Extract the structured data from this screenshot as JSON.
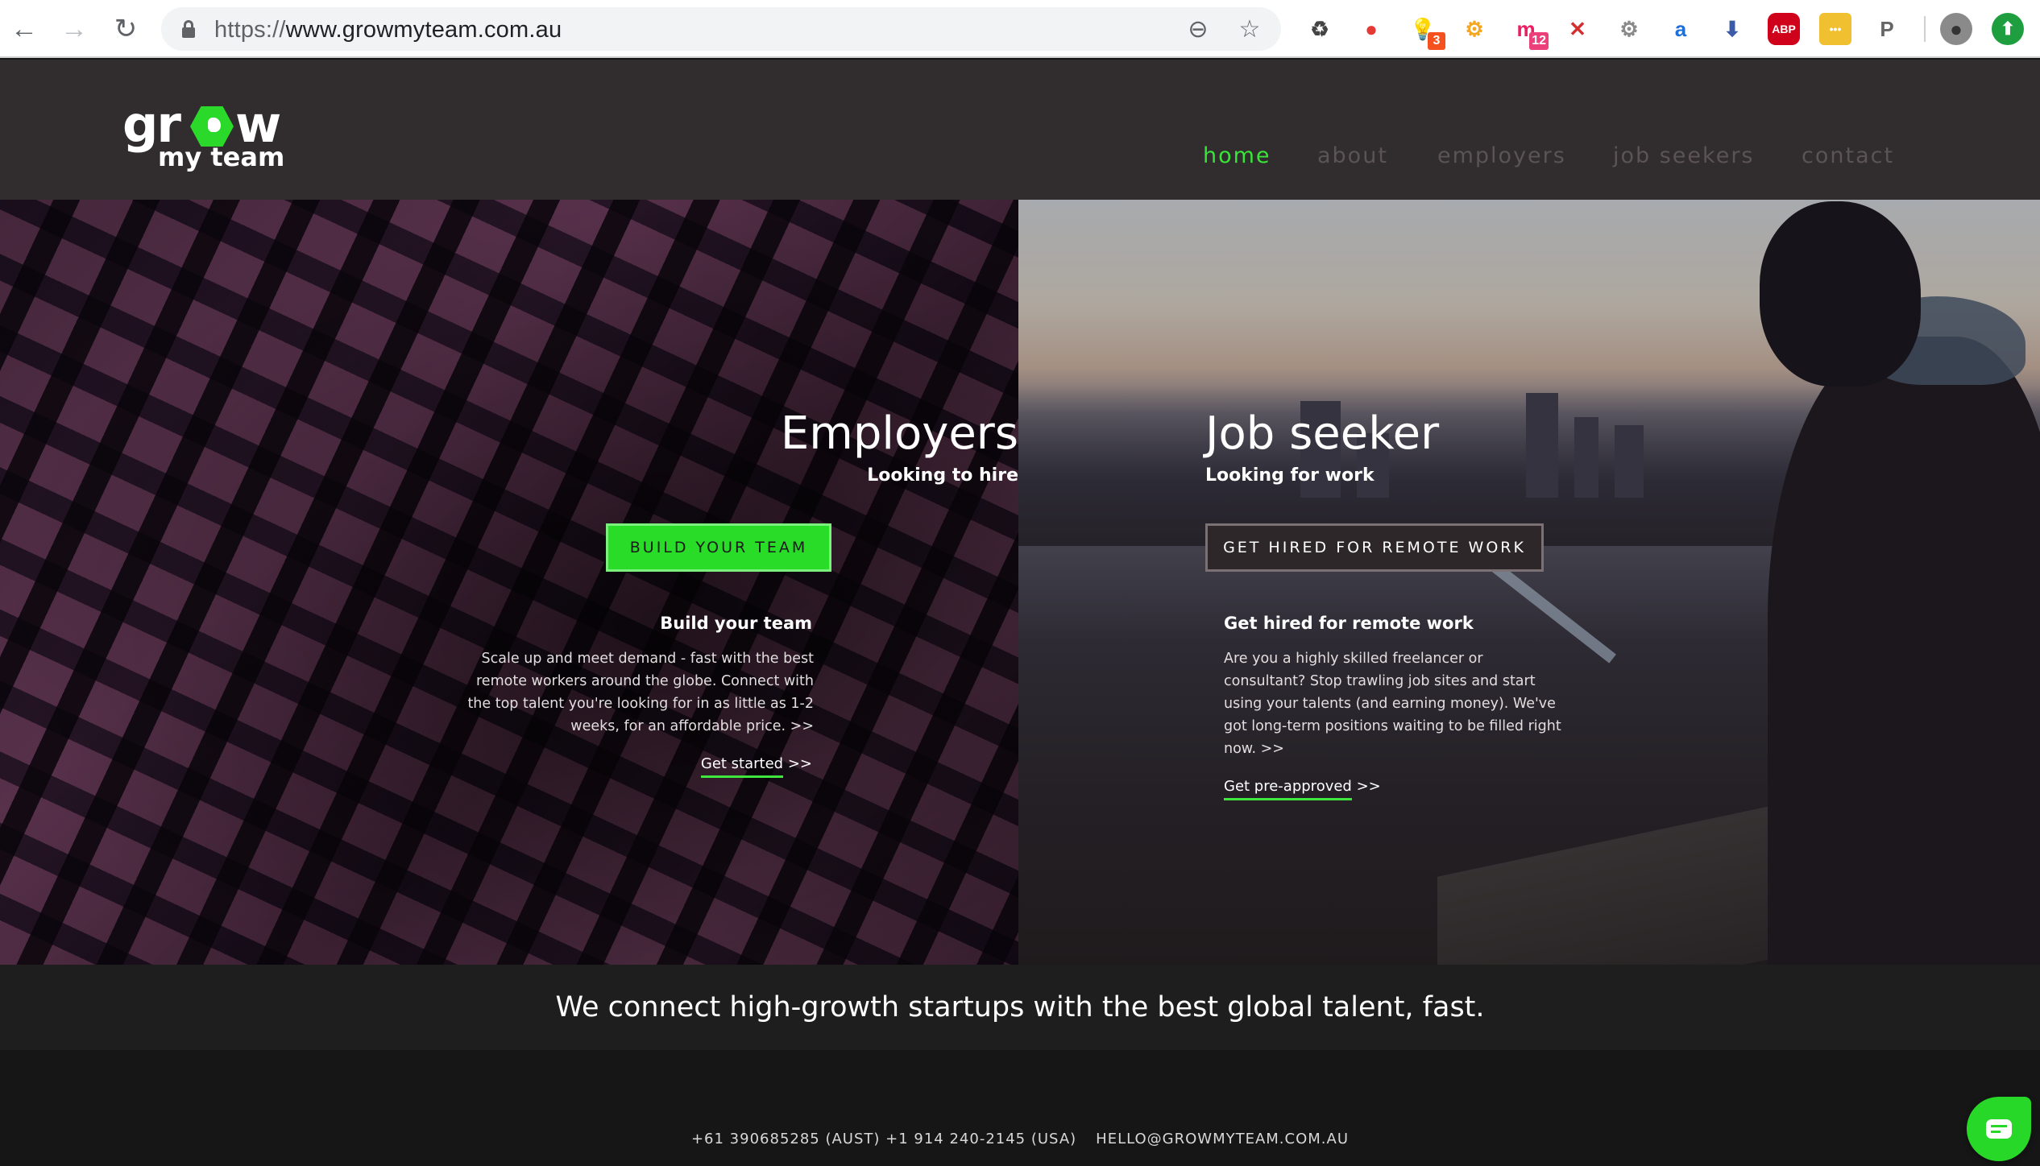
{
  "browser": {
    "url_scheme": "https://",
    "url_host": "www.growmyteam.com.au",
    "back_glyph": "←",
    "forward_glyph": "→",
    "reload_glyph": "↻",
    "zoom_glyph": "⊖",
    "bookmark_glyph": "☆",
    "extensions": [
      {
        "name": "recycle-extension",
        "glyph": "♻",
        "color": "#444444"
      },
      {
        "name": "color-wheel-extension",
        "glyph": "●",
        "color": "#e53935"
      },
      {
        "name": "bulb-extension",
        "glyph": "💡",
        "color": "#f4c542",
        "badge": "3",
        "badge_color": "#f4511e"
      },
      {
        "name": "accessibility-gear-extension",
        "glyph": "⚙",
        "color": "#f5a623"
      },
      {
        "name": "m-extension",
        "glyph": "m",
        "color": "#e91e63",
        "badge": "12",
        "badge_color": "#ec407a"
      },
      {
        "name": "pokeball-blocked-extension",
        "glyph": "✕",
        "color": "#d32f2f"
      },
      {
        "name": "settings-gear-extension",
        "glyph": "⚙",
        "color": "#8a8a8a"
      },
      {
        "name": "a-extension",
        "glyph": "a",
        "color": "#1e6fd9"
      },
      {
        "name": "png-download-extension",
        "glyph": "⬇",
        "color": "#3b5ba9"
      },
      {
        "name": "adblock-extension",
        "glyph": "ABP",
        "color": "#d0021b"
      },
      {
        "name": "lastpass-extension",
        "glyph": "•••",
        "color": "#f0c030"
      },
      {
        "name": "p-extension",
        "glyph": "P",
        "color": "#666666"
      },
      {
        "name": "profile-avatar",
        "glyph": "●",
        "color": "#555555"
      },
      {
        "name": "update-extension",
        "glyph": "⬆",
        "color": "#1e9e3e"
      }
    ]
  },
  "header": {
    "logo": {
      "line1_a": "gr",
      "line1_b": "w",
      "line2": "my team"
    },
    "nav": [
      {
        "label": "home",
        "active": true
      },
      {
        "label": "about",
        "active": false
      },
      {
        "label": "employers",
        "active": false
      },
      {
        "label": "job seekers",
        "active": false
      },
      {
        "label": "contact",
        "active": false
      }
    ],
    "accent_color": "#39e539"
  },
  "hero": {
    "employers": {
      "title": "Employers",
      "subtitle": "Looking to hire",
      "button": "BUILD YOUR TEAM",
      "card_title": "Build your team",
      "card_text": "Scale up and meet demand - fast with the best remote workers around the globe. Connect with the top talent you're looking for in as little as 1-2 weeks, for an affordable price. >>",
      "link": "Get started",
      "link_suffix": " >>"
    },
    "job_seeker": {
      "title": "Job seeker",
      "subtitle": "Looking for work",
      "button": "GET HIRED FOR REMOTE WORK",
      "card_title": "Get hired for remote work",
      "card_text": "Are you a highly skilled freelancer or consultant? Stop trawling job sites and start using your talents (and earning money). We've got long-term positions waiting to be filled right now.  >>",
      "link": "Get pre-approved",
      "link_suffix": " >>"
    }
  },
  "tagline": "We connect high-growth startups with the best global talent, fast.",
  "footer": {
    "phones": "+61 390685285 (AUST) +1 914 240-2145 (USA)",
    "email": "HELLO@GROWMYTEAM.COM.AU"
  },
  "chat_widget": {
    "icon": "chat-bubble"
  }
}
